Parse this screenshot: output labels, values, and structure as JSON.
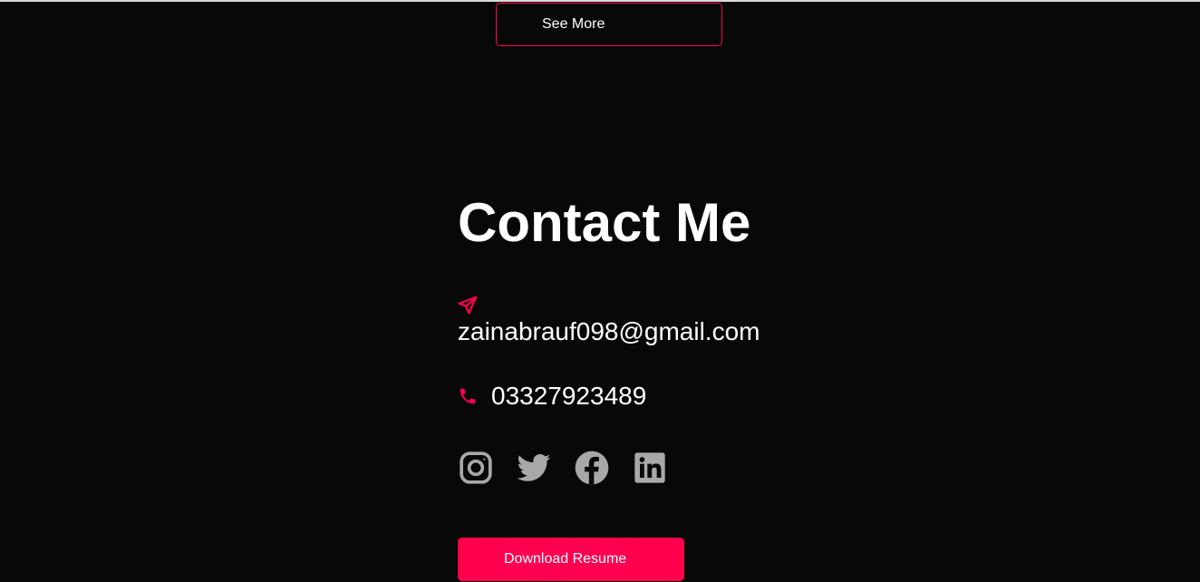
{
  "see_more": {
    "label": "See More"
  },
  "contact": {
    "title": "Contact Me",
    "email": "zainabrauf098@gmail.com",
    "phone": "03327923489",
    "email_icon": "paper-plane-icon",
    "phone_icon": "phone-icon"
  },
  "social": [
    {
      "name": "instagram-icon"
    },
    {
      "name": "twitter-icon"
    },
    {
      "name": "facebook-icon"
    },
    {
      "name": "linkedin-icon"
    }
  ],
  "download": {
    "label": "Download Resume"
  },
  "colors": {
    "background": "#080808",
    "accent": "#ff004f",
    "text": "#ffffff",
    "icon_gray": "#a8a8a8"
  }
}
